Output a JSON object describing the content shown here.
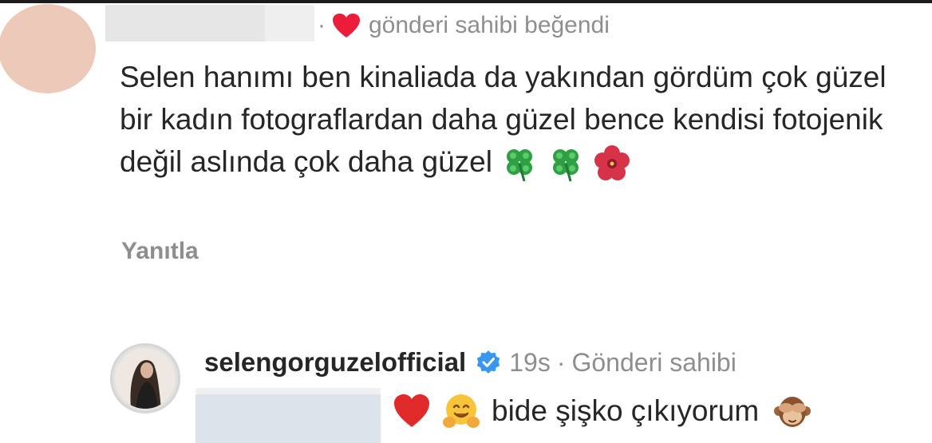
{
  "comment": {
    "liked_label": "gönderi sahibi beğendi",
    "separator": "·",
    "text": "Selen hanımı ben kinaliada da yakından gördüm çok güzel bir kadın fotograflardan daha güzel bence kendisi fotojenik değil aslında çok daha güzel",
    "emojis": [
      "four-leaf-clover",
      "four-leaf-clover",
      "hibiscus"
    ],
    "reply_label": "Yanıtla"
  },
  "owner_reply": {
    "username": "selengorguzelofficial",
    "time": "19s",
    "separator": "·",
    "role": "Gönderi sahibi",
    "text": "bide şişko çıkıyorum",
    "leading_emojis": [
      "red-heart",
      "hugging-face"
    ],
    "trailing_emoji": "see-no-evil-monkey"
  },
  "colors": {
    "text": "#262626",
    "muted": "#8e8e8e",
    "like_red": "#ed1c3b",
    "verified_blue": "#3897f0"
  }
}
